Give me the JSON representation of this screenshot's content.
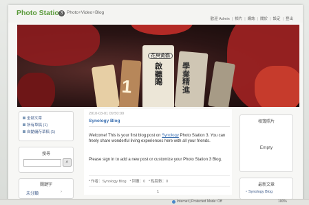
{
  "header": {
    "logo_text": "Photo Station",
    "badge": "3",
    "subtitle": "Photo+Video+Blog",
    "top_links": [
      "歡迎 Admin",
      "相片",
      "網誌",
      "關於",
      "設定",
      "登出"
    ]
  },
  "banner": {
    "alt_description": "",
    "tag_big_char": "1",
    "tag_char_top": "花與黃鶴",
    "tag_char_left": "啟聽賜",
    "tag_char_right": "學業精進"
  },
  "sidebar_left": {
    "categories": [
      {
        "label": "全部文章"
      },
      {
        "label": "所有草稿 (1)"
      },
      {
        "label": "自動儲存草稿 (1)"
      }
    ],
    "search": {
      "heading": "搜尋",
      "placeholder": "",
      "button_icon": "search-icon"
    },
    "tags": {
      "heading": "關鍵字",
      "row_label": "未分類",
      "row_arrow": "›"
    }
  },
  "post": {
    "date": "2010-03-01 09:50:00",
    "title": "Synology Blog",
    "body_part1": "Welcome! This is your first blog post on",
    "body_link": "Synology",
    "body_part2": "Photo Station 3. You can freely share wonderful living experiences here with all your friends.",
    "body_second": "Please sign in to add a new post or customize your Photo Station 3 Blog.",
    "meta": {
      "author": "作者：Synology Blog",
      "comments": "回覆：0",
      "views": "點閱數：0"
    },
    "page_number": "1"
  },
  "sidebar_right": {
    "photos_heading": "相簿照片",
    "photos_empty": "Empty",
    "latest_heading": "最新文章",
    "latest_item": "Synology Blog"
  },
  "statusbar": {
    "zone": "Internet | Protected Mode: Off",
    "zoom": "100%"
  },
  "colors": {
    "logo": "#5a9a3a",
    "link": "#3a6fb0",
    "banner_red": "#a12222"
  }
}
